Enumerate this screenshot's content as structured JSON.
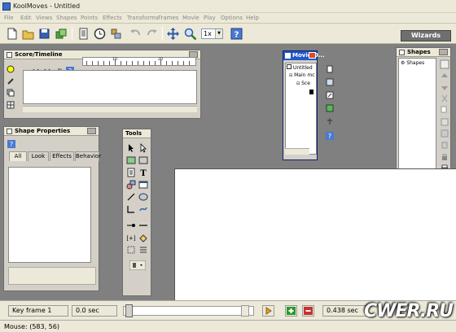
{
  "window": {
    "title": "KoolMoves - Untitled"
  },
  "menu": [
    "File",
    "Edit",
    "Views",
    "Shapes",
    "Points",
    "Effects",
    "Transforms",
    "Frames",
    "Movie",
    "Play",
    "Options",
    "Help"
  ],
  "toolbar": {
    "zoom_value": "1x",
    "wizards_label": "Wizards",
    "icons": [
      "new-file-icon",
      "open-folder-icon",
      "save-icon",
      "import-icon",
      "document-icon",
      "clock-icon",
      "library-icon",
      "undo-icon",
      "redo-icon",
      "move-icon",
      "zoom-icon",
      "help-icon"
    ]
  },
  "score_panel": {
    "title": "Score/Timeline",
    "ruler_labels": [
      "10",
      "20"
    ]
  },
  "shape_properties": {
    "title": "Shape Properties",
    "tabs": [
      "All",
      "Look",
      "Effects",
      "Behavior"
    ],
    "active_tab": "All"
  },
  "tools_panel": {
    "title": "Tools"
  },
  "movie_overview": {
    "title": "Movie O...",
    "tree": [
      {
        "label": "Untitled",
        "level": 0
      },
      {
        "label": "Main mc",
        "level": 1
      },
      {
        "label": "Sce",
        "level": 2
      }
    ]
  },
  "shapes_panel": {
    "title": "Shapes",
    "items": [
      "Shapes"
    ]
  },
  "framebar": {
    "key_frame": "Key frame 1",
    "time_start": "0.0 sec",
    "time_end": "0.438 sec"
  },
  "statusbar": {
    "mouse": "Mouse: (583, 56)"
  },
  "watermark": "CWER.RU",
  "colors": {
    "chrome": "#ece9d8",
    "panel": "#d4d0c8",
    "workspace": "#808080",
    "active_title": "#2058c8",
    "play_orange": "#e0a030",
    "add_green": "#2a9a2a",
    "remove_red": "#c83030"
  }
}
